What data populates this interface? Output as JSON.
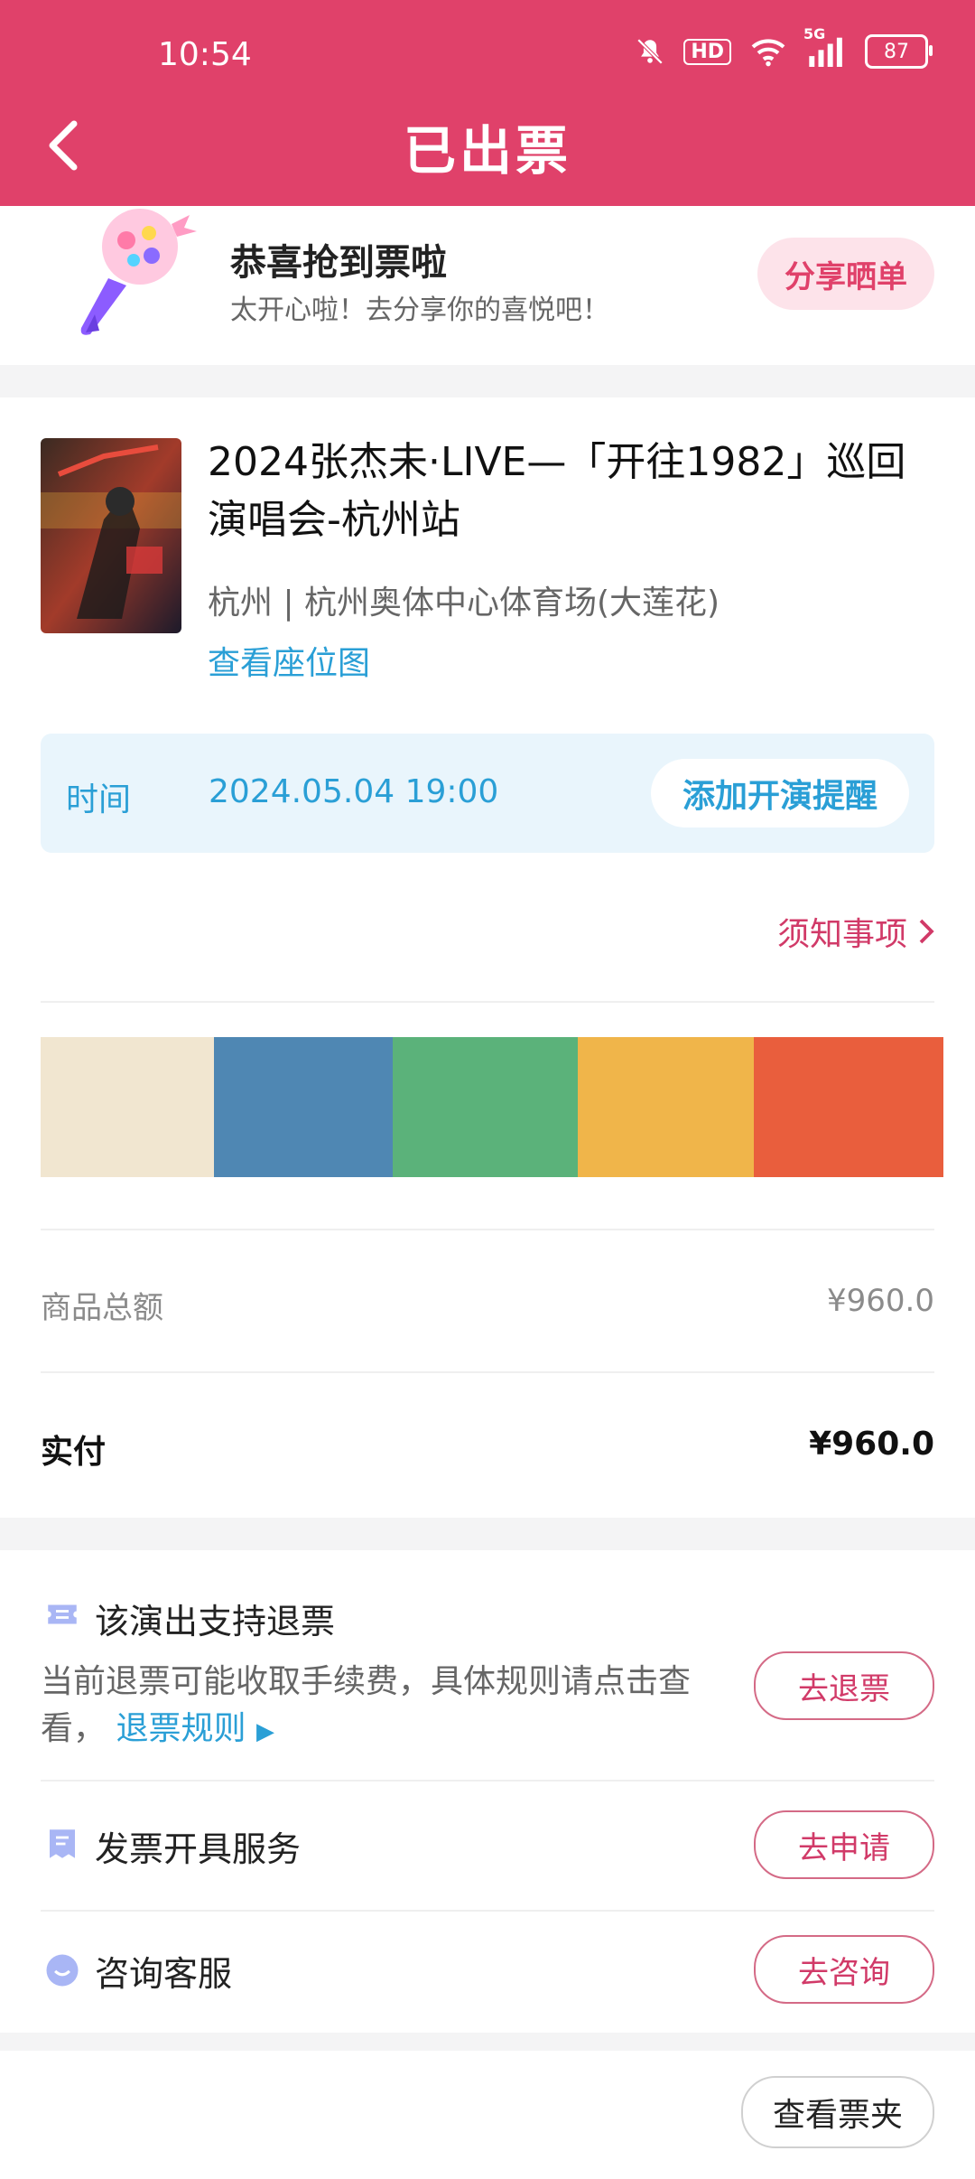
{
  "status_bar": {
    "time": "10:54",
    "hd": "HD",
    "network": "5G",
    "battery": "87"
  },
  "header": {
    "title": "已出票"
  },
  "congrats": {
    "title": "恭喜抢到票啦",
    "subtitle": "太开心啦！去分享你的喜悦吧！",
    "share_label": "分享晒单"
  },
  "show": {
    "title": "2024张杰未·LIVE—「开往1982」巡回演唱会-杭州站",
    "venue": "杭州 | 杭州奥体中心体育场(大莲花)",
    "seatmap_label": "查看座位图",
    "time_label": "时间",
    "time_value": "2024.05.04 19:00",
    "remind_label": "添加开演提醒",
    "notice_label": "须知事项"
  },
  "ticket_colors": [
    "#f1e6d0",
    "#4f87b3",
    "#5bb27a",
    "#f0b54a",
    "#e95e3d"
  ],
  "amounts": {
    "subtotal_label": "商品总额",
    "subtotal_value": "¥960.0",
    "paid_label": "实付",
    "paid_value": "¥960.0"
  },
  "services": {
    "refund_title": "该演出支持退票",
    "refund_desc": "当前退票可能收取手续费，具体规则请点击查看，",
    "refund_rule_link": "退票规则",
    "refund_button": "去退票",
    "invoice_title": "发票开具服务",
    "invoice_button": "去申请",
    "support_title": "咨询客服",
    "support_button": "去咨询"
  },
  "bottom": {
    "wallet_button": "查看票夹"
  },
  "colors": {
    "brand": "#e0416a",
    "link": "#2a9fd6",
    "accent_text": "#d13a68"
  }
}
